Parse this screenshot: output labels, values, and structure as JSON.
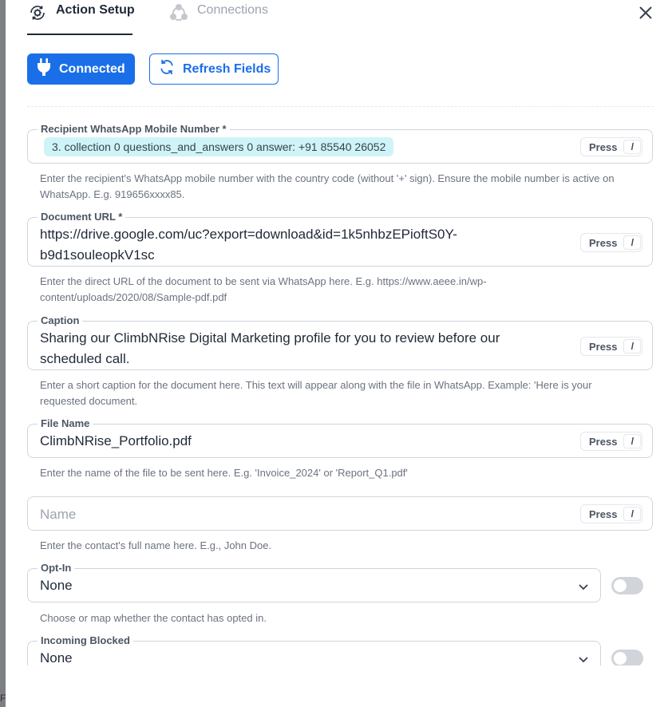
{
  "tabs": {
    "action_setup": "Action Setup",
    "connections": "Connections"
  },
  "buttons": {
    "connected": "Connected",
    "refresh": "Refresh Fields"
  },
  "press_label": "Press",
  "press_key": "/",
  "fields": {
    "recipient": {
      "label": "Recipient WhatsApp Mobile Number *",
      "chip": "3. collection 0 questions_and_answers 0 answer: +91 85540 26052",
      "help": "Enter the recipient's WhatsApp mobile number with the country code (without '+' sign). Ensure the mobile number is active on WhatsApp. E.g. 919656xxxx85."
    },
    "document_url": {
      "label": "Document URL *",
      "value_line1": "https://drive.google.com/uc?export=download&id=1k5nhbzEPioftS0Y-",
      "value_line2": "b9d1souleopkV1sc",
      "help": "Enter the direct URL of the document to be sent via WhatsApp here. E.g. https://www.aeee.in/wp-content/uploads/2020/08/Sample-pdf.pdf"
    },
    "caption": {
      "label": "Caption",
      "value_line1": "Sharing our ClimbNRise Digital Marketing profile for you to review before our",
      "value_line2": "scheduled call.",
      "help": "Enter a short caption for the document here. This text will appear along with the file in WhatsApp. Example: 'Here is your requested document."
    },
    "file_name": {
      "label": "File Name",
      "value": "ClimbNRise_Portfolio.pdf",
      "help": "Enter the name of the file to be sent here. E.g. 'Invoice_2024' or 'Report_Q1.pdf'"
    },
    "name": {
      "placeholder": "Name",
      "help": "Enter the contact's full name here. E.g., John Doe."
    },
    "opt_in": {
      "label": "Opt-In",
      "value": "None",
      "help": "Choose or map whether the contact has opted in."
    },
    "incoming_blocked": {
      "label": "Incoming Blocked",
      "value": "None"
    }
  },
  "colors": {
    "accent": "#1a6fe8",
    "chip_bg": "#cff4f7"
  }
}
